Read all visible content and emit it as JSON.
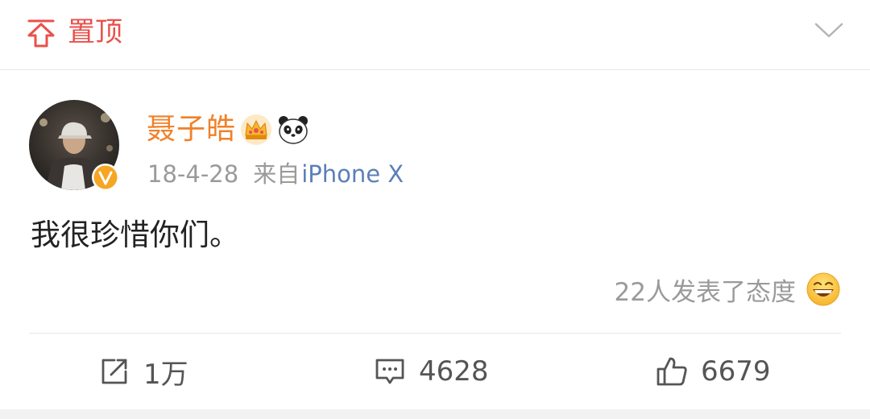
{
  "pinned": {
    "label": "置顶",
    "pin_icon": "pin-top-icon",
    "expand_icon": "chevron-down-icon",
    "accent_color": "#e8514b"
  },
  "post": {
    "author": {
      "name": "聂子皓",
      "name_color": "#f08029",
      "badges": [
        "crown-icon",
        "panda-icon"
      ],
      "verified_icon": "verified-v-icon"
    },
    "date": "18-4-28",
    "source_prefix": "来自",
    "source_device": "iPhone X",
    "text": "我很珍惜你们。",
    "reactions": {
      "text": "22人发表了态度",
      "icon": "grinning-face-icon"
    }
  },
  "actions": {
    "repost": {
      "icon": "repost-icon",
      "count": "1万"
    },
    "comment": {
      "icon": "comment-icon",
      "count": "4628"
    },
    "like": {
      "icon": "thumbs-up-icon",
      "count": "6679"
    }
  }
}
